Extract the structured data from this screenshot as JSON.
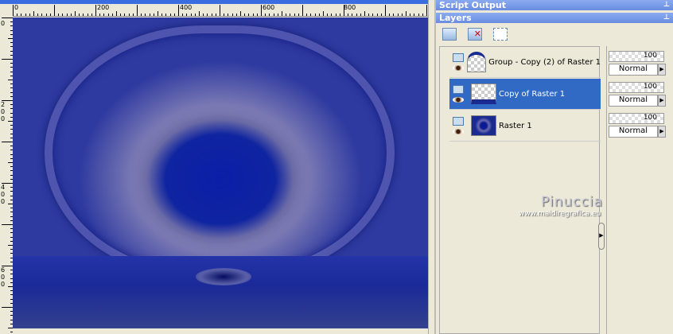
{
  "ruler": {
    "top_labels": [
      "0",
      "200",
      "400",
      "600",
      "800"
    ],
    "left_labels": [
      "0",
      "200",
      "400",
      "600"
    ]
  },
  "panels": {
    "script_output": "Script Output",
    "layers": "Layers"
  },
  "icons": {
    "new_layer": "new-raster-layer-icon",
    "delete": "delete-layer-icon",
    "edit_selection": "edit-selection-icon",
    "visibility": "eye-icon",
    "pin": "pin-icon"
  },
  "layers": [
    {
      "name": "Group - Copy (2) of Raster 1",
      "opacity": "100",
      "blend": "Normal",
      "selected": false
    },
    {
      "name": "Copy of Raster 1",
      "opacity": "100",
      "blend": "Normal",
      "selected": true
    },
    {
      "name": "Raster 1",
      "opacity": "100",
      "blend": "Normal",
      "selected": false
    }
  ],
  "watermark": {
    "name": "Pinuccia",
    "url": "www.maidiregrafica.eu"
  },
  "colors": {
    "selection": "#316ac5",
    "title_bar": "#7a9ae8"
  }
}
